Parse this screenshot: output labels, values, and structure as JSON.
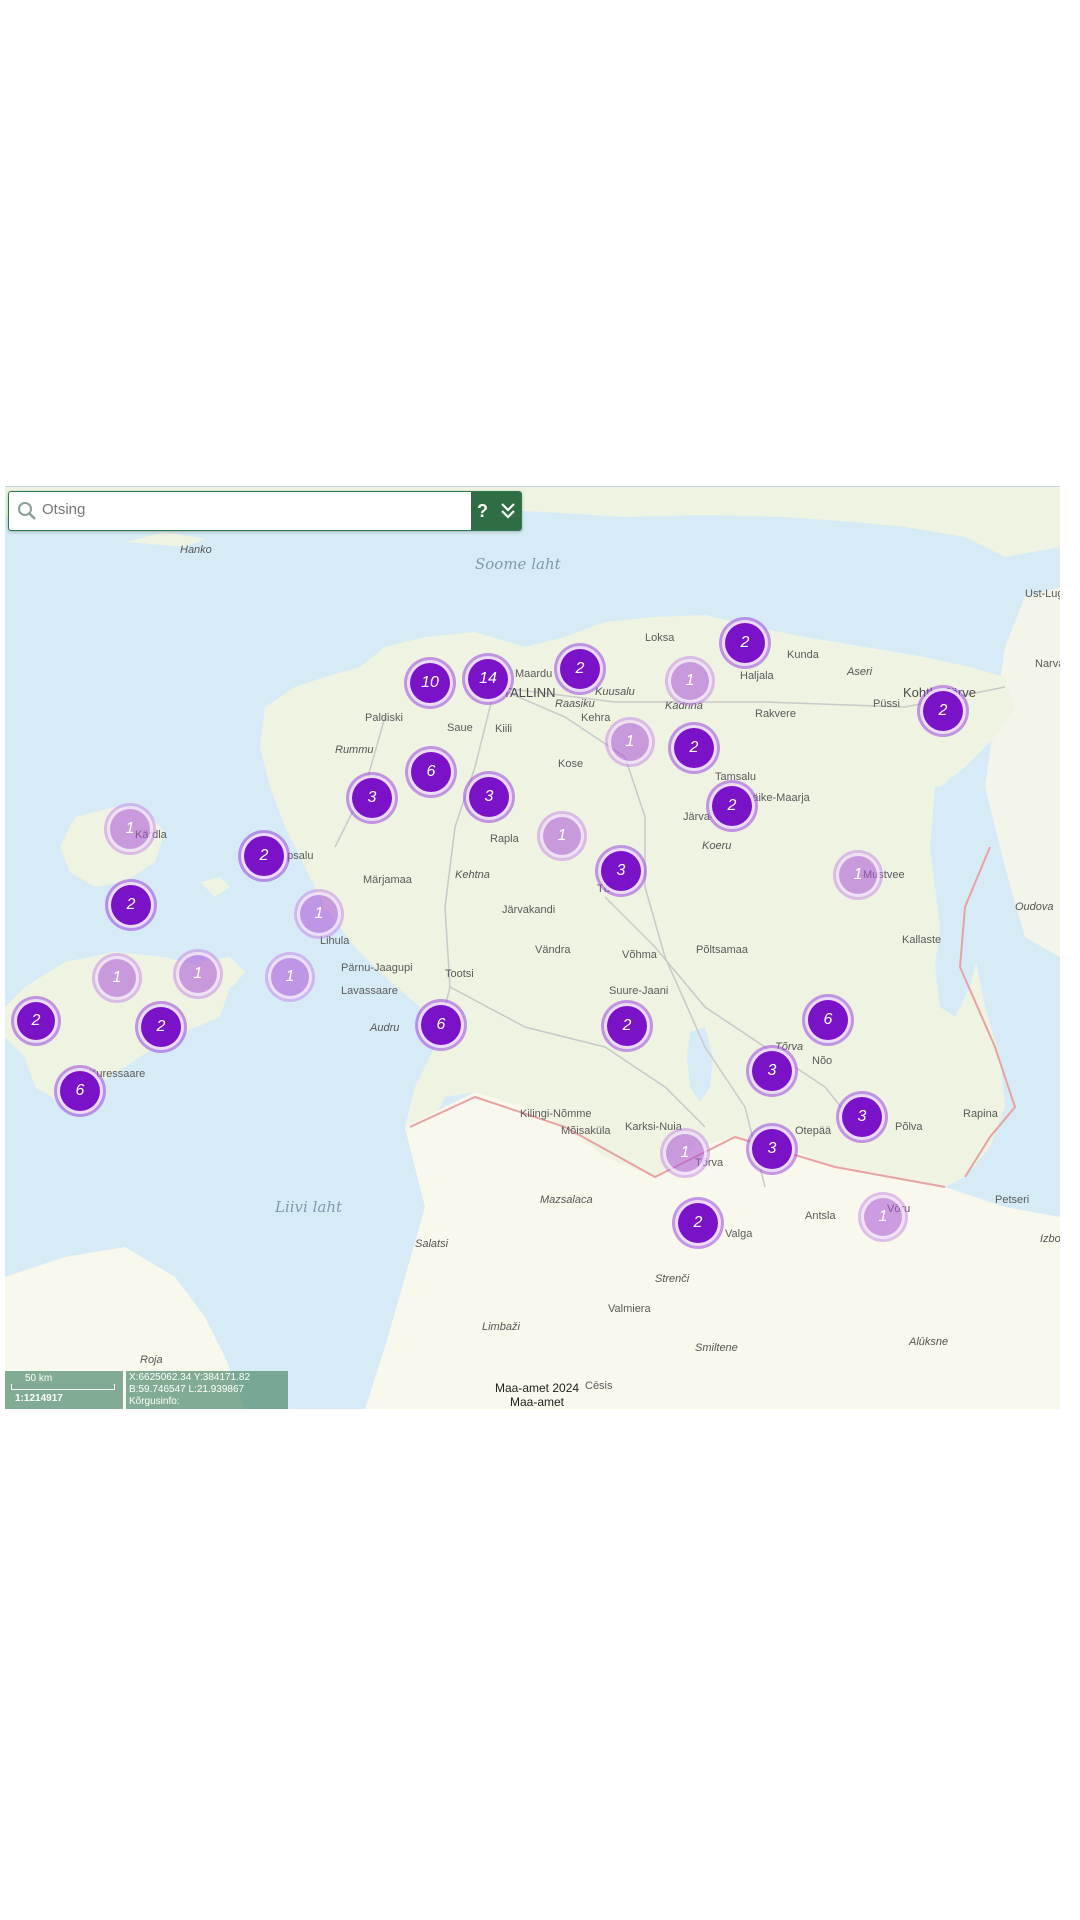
{
  "search": {
    "placeholder": "Otsing",
    "help_label": "?"
  },
  "places": [
    "Soome laht",
    "Hanko",
    "Loksa",
    "Kunda",
    "Aseri",
    "Haljala",
    "Kadrina",
    "Rakvere",
    "Püssi",
    "Kohtla-Järve",
    "Narva",
    "Ust-Luga",
    "Paldiski",
    "Rummu",
    "Saue",
    "Kiili",
    "Kose",
    "Kuusalu",
    "Kehra",
    "Raasiku",
    "Maardu",
    "TALLINN",
    "Tamsalu",
    "Väike-Maarja",
    "Kärdla",
    "Haapsalu",
    "Märjamaa",
    "Kehtna",
    "Rapla",
    "Järva-Jaani",
    "Koeru",
    "Türi",
    "Mustvee",
    "Oudova",
    "Kallaste",
    "Lihula",
    "Järvakandi",
    "Vändra",
    "Põltsamaa",
    "Võhma",
    "Pärnu-Jaagupi",
    "Tootsi",
    "Lavassaare",
    "Suure-Jaani",
    "Audru",
    "Pärnu",
    "Kuressaare",
    "Tõrva",
    "Nõo",
    "Rapina",
    "Põlva",
    "Otepää",
    "Kilingi-Nõmme",
    "Mõisaküla",
    "Karksi-Nuia",
    "Tõrva",
    "Valga",
    "Antsla",
    "Võru",
    "Petseri",
    "Izborsk",
    "Liivi laht",
    "Mazsalaca",
    "Salatsi",
    "Strenči",
    "Valmiera",
    "Limbaži",
    "Smiltene",
    "Alūksne",
    "Roja",
    "Cēsis"
  ],
  "clusters": [
    {
      "count": "10",
      "style": "strong"
    },
    {
      "count": "14",
      "style": "strong"
    },
    {
      "count": "2",
      "style": "strong"
    },
    {
      "count": "2",
      "style": "strong"
    },
    {
      "count": "1",
      "style": "faint"
    },
    {
      "count": "2",
      "style": "strong"
    },
    {
      "count": "1",
      "style": "faint"
    },
    {
      "count": "2",
      "style": "strong"
    },
    {
      "count": "6",
      "style": "strong"
    },
    {
      "count": "3",
      "style": "strong"
    },
    {
      "count": "3",
      "style": "strong"
    },
    {
      "count": "2",
      "style": "strong"
    },
    {
      "count": "1",
      "style": "faint"
    },
    {
      "count": "2",
      "style": "strong"
    },
    {
      "count": "1",
      "style": "faint"
    },
    {
      "count": "3",
      "style": "strong"
    },
    {
      "count": "1",
      "style": "faint"
    },
    {
      "count": "2",
      "style": "strong"
    },
    {
      "count": "1",
      "style": "faint"
    },
    {
      "count": "1",
      "style": "faint"
    },
    {
      "count": "1",
      "style": "faint"
    },
    {
      "count": "1",
      "style": "faint"
    },
    {
      "count": "2",
      "style": "strong"
    },
    {
      "count": "6",
      "style": "strong"
    },
    {
      "count": "6",
      "style": "strong"
    },
    {
      "count": "2",
      "style": "strong"
    },
    {
      "count": "6",
      "style": "strong"
    },
    {
      "count": "3",
      "style": "strong"
    },
    {
      "count": "3",
      "style": "strong"
    },
    {
      "count": "3",
      "style": "strong"
    },
    {
      "count": "1",
      "style": "faint"
    },
    {
      "count": "2",
      "style": "strong"
    },
    {
      "count": "1",
      "style": "faint"
    },
    {
      "count": "2",
      "style": "strong"
    }
  ],
  "scale": {
    "distance": "50 km",
    "ratio": "1:1214917"
  },
  "coords": {
    "xy": "X:6625062.34 Y:384171.82",
    "bl": "B:59.746547 L:21.939867",
    "height": "Kõrgusinfo:"
  },
  "credit": {
    "line1": "Maa-amet 2024",
    "line2": "Maa-amet"
  },
  "colors": {
    "cluster_strong": "#7a12c8",
    "cluster_faint": "#b060d8",
    "land": "#eef3e2",
    "sea": "#d7ebf6",
    "toolbar": "#2f6e45"
  }
}
